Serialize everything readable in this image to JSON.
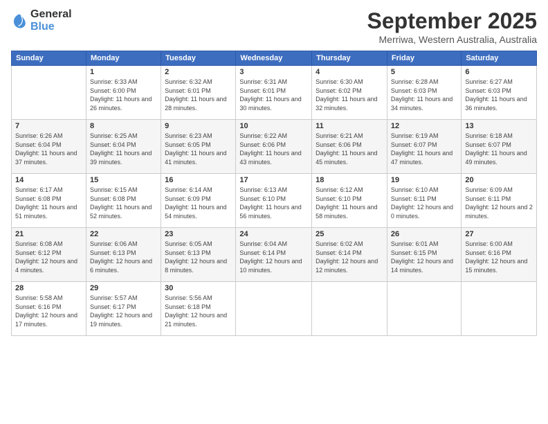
{
  "logo": {
    "general": "General",
    "blue": "Blue"
  },
  "header": {
    "month": "September 2025",
    "location": "Merriwa, Western Australia, Australia"
  },
  "weekdays": [
    "Sunday",
    "Monday",
    "Tuesday",
    "Wednesday",
    "Thursday",
    "Friday",
    "Saturday"
  ],
  "weeks": [
    [
      {
        "day": "",
        "info": ""
      },
      {
        "day": "1",
        "info": "Sunrise: 6:33 AM\nSunset: 6:00 PM\nDaylight: 11 hours\nand 26 minutes."
      },
      {
        "day": "2",
        "info": "Sunrise: 6:32 AM\nSunset: 6:01 PM\nDaylight: 11 hours\nand 28 minutes."
      },
      {
        "day": "3",
        "info": "Sunrise: 6:31 AM\nSunset: 6:01 PM\nDaylight: 11 hours\nand 30 minutes."
      },
      {
        "day": "4",
        "info": "Sunrise: 6:30 AM\nSunset: 6:02 PM\nDaylight: 11 hours\nand 32 minutes."
      },
      {
        "day": "5",
        "info": "Sunrise: 6:28 AM\nSunset: 6:03 PM\nDaylight: 11 hours\nand 34 minutes."
      },
      {
        "day": "6",
        "info": "Sunrise: 6:27 AM\nSunset: 6:03 PM\nDaylight: 11 hours\nand 36 minutes."
      }
    ],
    [
      {
        "day": "7",
        "info": "Sunrise: 6:26 AM\nSunset: 6:04 PM\nDaylight: 11 hours\nand 37 minutes."
      },
      {
        "day": "8",
        "info": "Sunrise: 6:25 AM\nSunset: 6:04 PM\nDaylight: 11 hours\nand 39 minutes."
      },
      {
        "day": "9",
        "info": "Sunrise: 6:23 AM\nSunset: 6:05 PM\nDaylight: 11 hours\nand 41 minutes."
      },
      {
        "day": "10",
        "info": "Sunrise: 6:22 AM\nSunset: 6:06 PM\nDaylight: 11 hours\nand 43 minutes."
      },
      {
        "day": "11",
        "info": "Sunrise: 6:21 AM\nSunset: 6:06 PM\nDaylight: 11 hours\nand 45 minutes."
      },
      {
        "day": "12",
        "info": "Sunrise: 6:19 AM\nSunset: 6:07 PM\nDaylight: 11 hours\nand 47 minutes."
      },
      {
        "day": "13",
        "info": "Sunrise: 6:18 AM\nSunset: 6:07 PM\nDaylight: 11 hours\nand 49 minutes."
      }
    ],
    [
      {
        "day": "14",
        "info": "Sunrise: 6:17 AM\nSunset: 6:08 PM\nDaylight: 11 hours\nand 51 minutes."
      },
      {
        "day": "15",
        "info": "Sunrise: 6:15 AM\nSunset: 6:08 PM\nDaylight: 11 hours\nand 52 minutes."
      },
      {
        "day": "16",
        "info": "Sunrise: 6:14 AM\nSunset: 6:09 PM\nDaylight: 11 hours\nand 54 minutes."
      },
      {
        "day": "17",
        "info": "Sunrise: 6:13 AM\nSunset: 6:10 PM\nDaylight: 11 hours\nand 56 minutes."
      },
      {
        "day": "18",
        "info": "Sunrise: 6:12 AM\nSunset: 6:10 PM\nDaylight: 11 hours\nand 58 minutes."
      },
      {
        "day": "19",
        "info": "Sunrise: 6:10 AM\nSunset: 6:11 PM\nDaylight: 12 hours\nand 0 minutes."
      },
      {
        "day": "20",
        "info": "Sunrise: 6:09 AM\nSunset: 6:11 PM\nDaylight: 12 hours\nand 2 minutes."
      }
    ],
    [
      {
        "day": "21",
        "info": "Sunrise: 6:08 AM\nSunset: 6:12 PM\nDaylight: 12 hours\nand 4 minutes."
      },
      {
        "day": "22",
        "info": "Sunrise: 6:06 AM\nSunset: 6:13 PM\nDaylight: 12 hours\nand 6 minutes."
      },
      {
        "day": "23",
        "info": "Sunrise: 6:05 AM\nSunset: 6:13 PM\nDaylight: 12 hours\nand 8 minutes."
      },
      {
        "day": "24",
        "info": "Sunrise: 6:04 AM\nSunset: 6:14 PM\nDaylight: 12 hours\nand 10 minutes."
      },
      {
        "day": "25",
        "info": "Sunrise: 6:02 AM\nSunset: 6:14 PM\nDaylight: 12 hours\nand 12 minutes."
      },
      {
        "day": "26",
        "info": "Sunrise: 6:01 AM\nSunset: 6:15 PM\nDaylight: 12 hours\nand 14 minutes."
      },
      {
        "day": "27",
        "info": "Sunrise: 6:00 AM\nSunset: 6:16 PM\nDaylight: 12 hours\nand 15 minutes."
      }
    ],
    [
      {
        "day": "28",
        "info": "Sunrise: 5:58 AM\nSunset: 6:16 PM\nDaylight: 12 hours\nand 17 minutes."
      },
      {
        "day": "29",
        "info": "Sunrise: 5:57 AM\nSunset: 6:17 PM\nDaylight: 12 hours\nand 19 minutes."
      },
      {
        "day": "30",
        "info": "Sunrise: 5:56 AM\nSunset: 6:18 PM\nDaylight: 12 hours\nand 21 minutes."
      },
      {
        "day": "",
        "info": ""
      },
      {
        "day": "",
        "info": ""
      },
      {
        "day": "",
        "info": ""
      },
      {
        "day": "",
        "info": ""
      }
    ]
  ]
}
